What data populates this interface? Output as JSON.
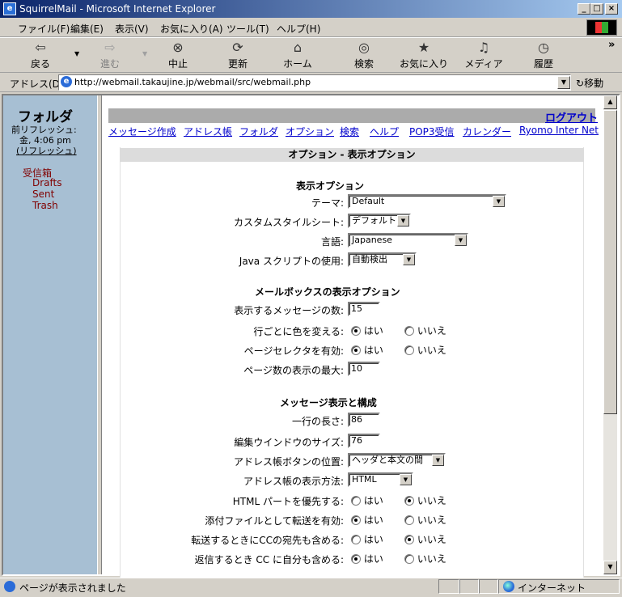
{
  "window": {
    "title": "SquirrelMail - Microsoft Internet Explorer",
    "min": "_",
    "max": "□",
    "close": "×"
  },
  "menu": [
    "ファイル(F)",
    "編集(E)",
    "表示(V)",
    "お気に入り(A)",
    "ツール(T)",
    "ヘルプ(H)"
  ],
  "toolbar": {
    "back": "戻る",
    "forward": "進む",
    "stop": "中止",
    "refresh": "更新",
    "home": "ホーム",
    "search": "検索",
    "favorites": "お気に入り",
    "media": "メディア",
    "history": "履歴",
    "more": "»"
  },
  "address": {
    "label": "アドレス(D)",
    "url": "http://webmail.takaujine.jp/webmail/src/webmail.php",
    "go": "移動"
  },
  "sidebar": {
    "title": "フォルダ",
    "last_refresh": "前リフレッシュ:",
    "time": "金, 4:06 pm",
    "refresh_link": "(リフレッシュ)",
    "folders": [
      "受信箱",
      "Drafts",
      "Sent",
      "Trash"
    ]
  },
  "topnav": {
    "logout": "ログアウト",
    "links": [
      "メッセージ作成",
      "アドレス帳",
      "フォルダ",
      "オプション",
      "検索",
      "ヘルプ",
      "POP3受信",
      "カレンダー",
      "Ryomo Inter Net"
    ]
  },
  "panel": {
    "title": "オプション - 表示オプション",
    "sections": {
      "display": "表示オプション",
      "mailbox": "メールボックスの表示オプション",
      "message": "メッセージ表示と構成"
    },
    "labels": {
      "theme": "テーマ:",
      "css": "カスタムスタイルシート:",
      "lang": "言語:",
      "js": "Java スクリプトの使用:",
      "msg_count": "表示するメッセージの数:",
      "alt_colors": "行ごとに色を変える:",
      "page_selector": "ページセレクタを有効:",
      "max_pages": "ページ数の表示の最大:",
      "line_len": "一行の長さ:",
      "compose_size": "編集ウインドウのサイズ:",
      "addr_btn_pos": "アドレス帳ボタンの位置:",
      "addr_display": "アドレス帳の表示方法:",
      "html_pref": "HTML パートを優先する:",
      "forward_attach": "添付ファイルとして転送を有効:",
      "forward_cc": "転送するときにCCの宛先も含める:",
      "reply_cc_self": "返信するとき CC に自分も含める:",
      "cutoff": "…"
    },
    "values": {
      "theme": "Default",
      "css": "デフォルト",
      "lang": "Japanese",
      "js": "自動検出",
      "msg_count": "15",
      "max_pages": "10",
      "line_len": "86",
      "compose_size": "76",
      "addr_btn_pos": "ヘッダと本文の間",
      "addr_display": "HTML"
    },
    "yes": "はい",
    "no": "いいえ"
  },
  "status": {
    "text": "ページが表示されました",
    "zone": "インターネット"
  }
}
